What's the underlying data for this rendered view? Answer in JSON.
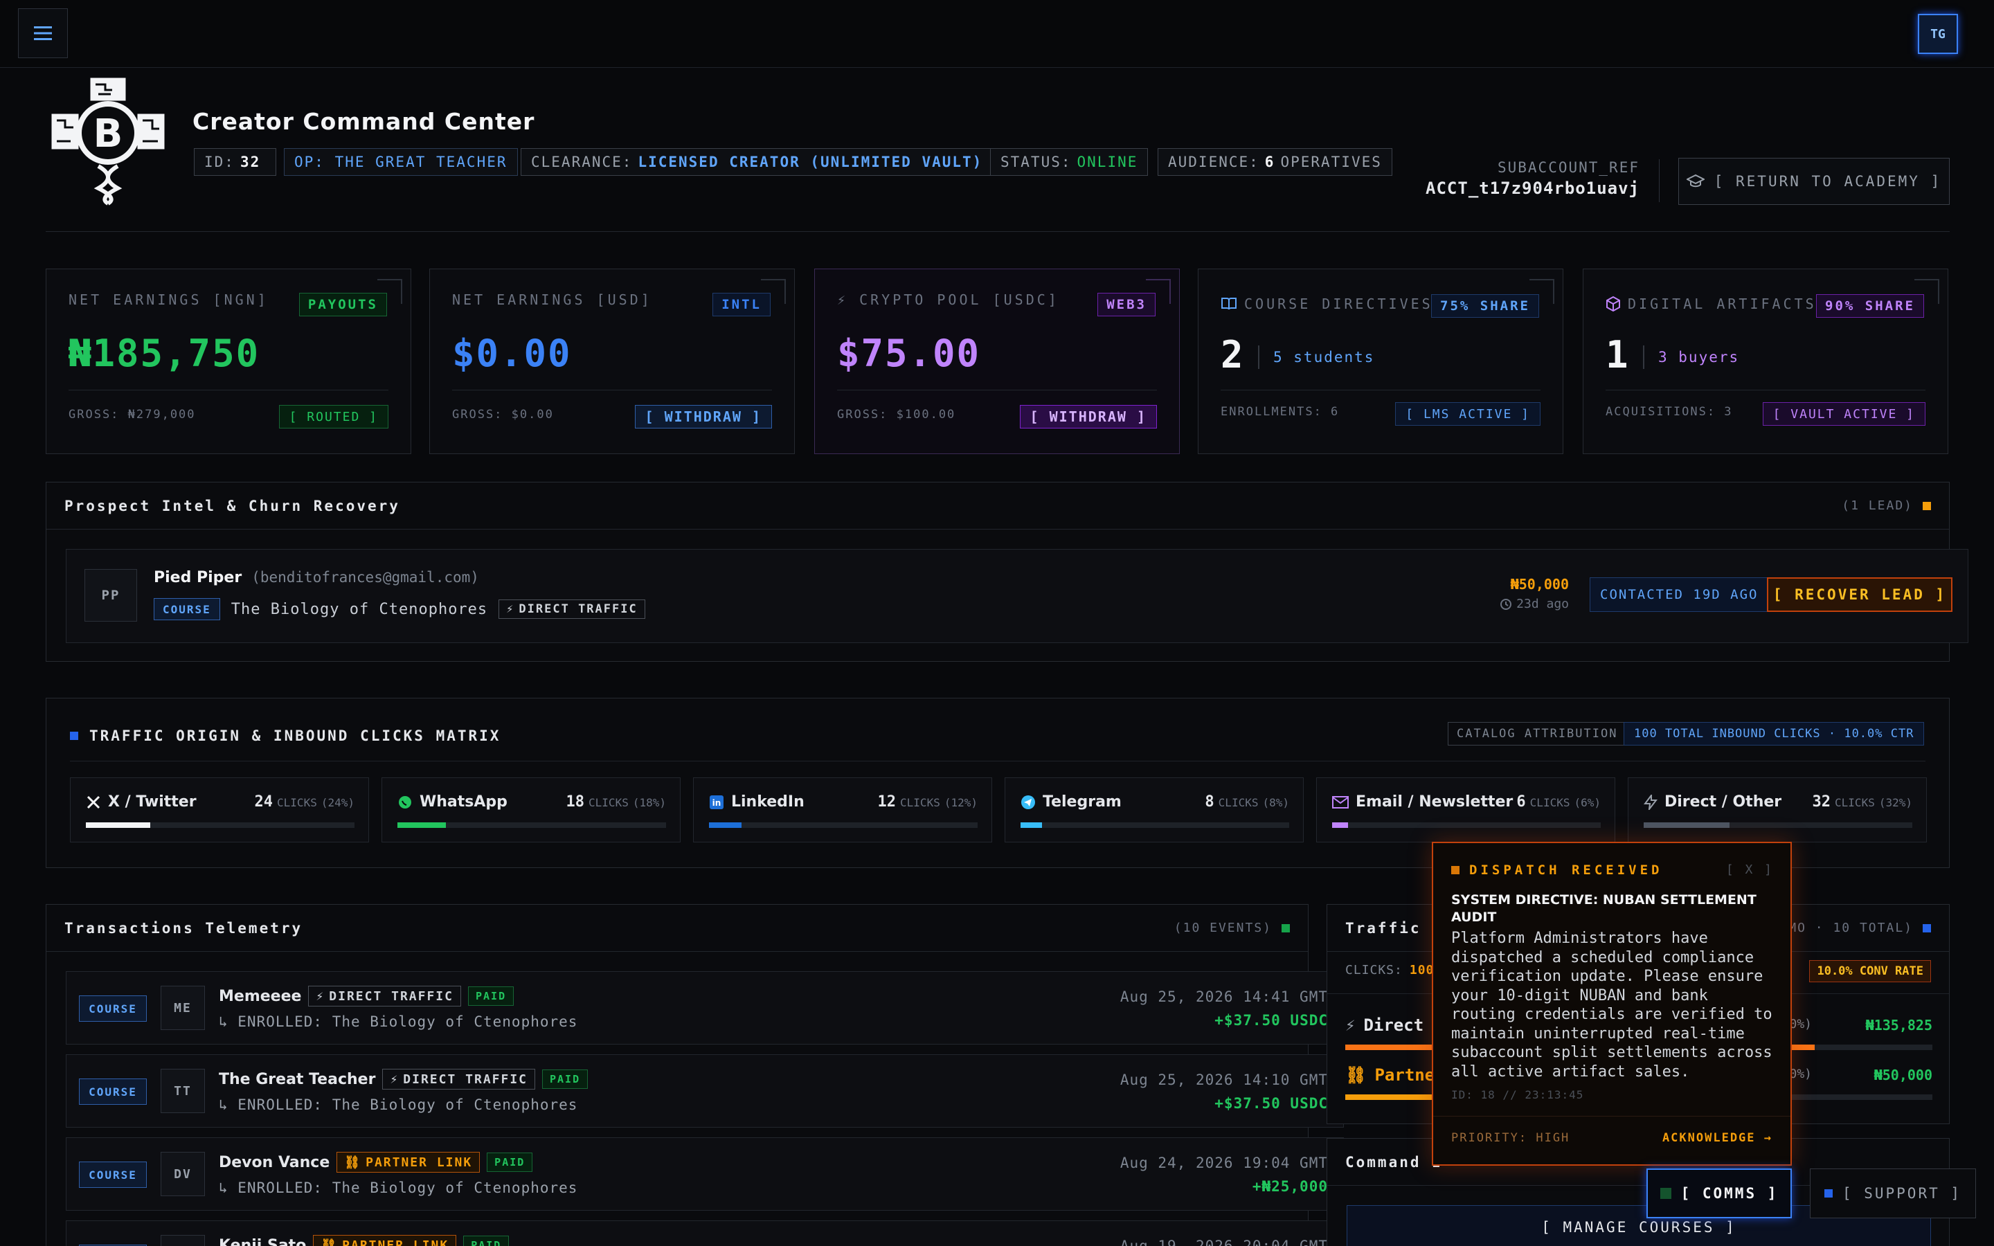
{
  "topbar": {
    "avatar_initials": "TG"
  },
  "header": {
    "title": "Creator Command Center",
    "chips": {
      "id_label": "ID:",
      "id_value": "32",
      "op": "OP: THE GREAT TEACHER",
      "clearance_label": "CLEARANCE:",
      "clearance_value": "LICENSED CREATOR (UNLIMITED VAULT)",
      "status_label": "STATUS:",
      "status_value": "ONLINE",
      "audience_label": "AUDIENCE:",
      "audience_value": "6",
      "audience_unit": "OPERATIVES"
    },
    "subaccount_label": "SUBACCOUNT_REF",
    "subaccount_value": "ACCT_t17z904rbo1uavj",
    "return_label": "[ RETURN TO ACADEMY ]"
  },
  "stats": [
    {
      "label": "NET EARNINGS [NGN]",
      "tag": "PAYOUTS",
      "value": "₦185,750",
      "gross": "GROSS: ₦279,000",
      "action": "[ ROUTED ]",
      "color": "#22c55e"
    },
    {
      "label": "NET EARNINGS [USD]",
      "tag": "INTL",
      "value": "$0.00",
      "gross": "GROSS: $0.00",
      "action": "[ WITHDRAW ]",
      "color": "#3b82f6"
    },
    {
      "label": "⚡ CRYPTO POOL [USDC]",
      "tag": "WEB3",
      "value": "$75.00",
      "gross": "GROSS: $100.00",
      "action": "[ WITHDRAW ]",
      "color": "#c084fc"
    },
    {
      "label": "COURSE DIRECTIVES",
      "tag": "75% SHARE",
      "count": "2",
      "count_sub": "5 students",
      "gross": "ENROLLMENTS: 6",
      "action": "[ LMS ACTIVE ]",
      "color": "#60a5fa"
    },
    {
      "label": "DIGITAL ARTIFACTS",
      "tag": "90% SHARE",
      "count": "1",
      "count_sub": "3 buyers",
      "gross": "ACQUISITIONS: 3",
      "action": "[ VAULT ACTIVE ]",
      "color": "#c084fc"
    }
  ],
  "prospect": {
    "title": "Prospect Intel & Churn Recovery",
    "meta": "(1 LEAD)",
    "lead": {
      "initials": "PP",
      "name": "Pied Piper",
      "email": "(benditofrances@gmail.com)",
      "type": "COURSE",
      "course": "The Biology of Ctenophores",
      "source": "DIRECT TRAFFIC",
      "amount": "₦50,000",
      "age": "23d ago",
      "contacted": "CONTACTED 19D AGO",
      "recover": "[ RECOVER LEAD ]"
    }
  },
  "traffic": {
    "title": "TRAFFIC ORIGIN & INBOUND CLICKS MATRIX",
    "attribution": "CATALOG ATTRIBUTION",
    "total": "100 TOTAL INBOUND CLICKS · 10.0% CTR",
    "clicks_word": "CLICKS",
    "sources": [
      {
        "name": "X / Twitter",
        "count": "24",
        "pct": "(24%)",
        "share": 0.24,
        "color": "#f3f4f6",
        "icon": "x-icon"
      },
      {
        "name": "WhatsApp",
        "count": "18",
        "pct": "(18%)",
        "share": 0.18,
        "color": "#22c55e",
        "icon": "whatsapp-icon"
      },
      {
        "name": "LinkedIn",
        "count": "12",
        "pct": "(12%)",
        "share": 0.12,
        "color": "#1d6fd8",
        "icon": "linkedin-icon"
      },
      {
        "name": "Telegram",
        "count": "8",
        "pct": "(8%)",
        "share": 0.08,
        "color": "#38bdf8",
        "icon": "telegram-icon"
      },
      {
        "name": "Email / Newsletter",
        "count": "6",
        "pct": "(6%)",
        "share": 0.06,
        "color": "#c084fc",
        "icon": "mail-icon"
      },
      {
        "name": "Direct / Other",
        "count": "32",
        "pct": "(32%)",
        "share": 0.32,
        "color": "#4b5563",
        "icon": "bolt-icon"
      }
    ]
  },
  "transactions": {
    "title": "Transactions Telemetry",
    "meta": "(10 EVENTS)",
    "rows": [
      {
        "type": "COURSE",
        "initials": "ME",
        "name": "Memeeee",
        "source": "DIRECT TRAFFIC",
        "status": "PAID",
        "enrolled": "↳ ENROLLED: The Biology of Ctenophores",
        "date": "Aug 25, 2026 14:41 GMT",
        "amount": "+$37.50 USDC"
      },
      {
        "type": "COURSE",
        "initials": "TT",
        "name": "The Great Teacher",
        "source": "DIRECT TRAFFIC",
        "status": "PAID",
        "enrolled": "↳ ENROLLED: The Biology of Ctenophores",
        "date": "Aug 25, 2026 14:10 GMT",
        "amount": "+$37.50 USDC"
      },
      {
        "type": "COURSE",
        "initials": "DV",
        "name": "Devon Vance",
        "source": "PARTNER LINK",
        "status": "PAID",
        "enrolled": "↳ ENROLLED: The Biology of Ctenophores",
        "date": "Aug 24, 2026 19:04 GMT",
        "amount": "+₦25,000"
      },
      {
        "type": "COURSE",
        "initials": "KS",
        "name": "Kenji Sato",
        "source": "PARTNER LINK",
        "status": "PAID",
        "enrolled": "",
        "date": "Aug 19, 2026 20:04 GMT",
        "amount": ""
      }
    ]
  },
  "traffic_origin": {
    "title_partial": "Traffic O",
    "meta_partial": "PROMO · 10 TOTAL)",
    "clicks_label": "CLICKS:",
    "clicks_value": "100",
    "conv_rate": "10.0% CONV RATE",
    "rows": [
      {
        "name": "Direct",
        "pct_partial": "O (80%)",
        "amount": "₦135,825",
        "share": 0.8,
        "color": "#f97316"
      },
      {
        "name": "Partne",
        "pct_partial": "ID (20%)",
        "amount": "₦50,000",
        "share": 0.2,
        "color": "#f59e0b"
      }
    ]
  },
  "command": {
    "title_partial": "Command I",
    "manage": "[ MANAGE COURSES ]"
  },
  "dispatch": {
    "header": "DISPATCH RECEIVED",
    "close": "[ X ]",
    "subject": "SYSTEM DIRECTIVE: NUBAN SETTLEMENT AUDIT",
    "body": "Platform Administrators have dispatched a scheduled compliance verification update. Please ensure your 10-digit NUBAN and bank routing credentials are verified to maintain uninterrupted real-time subaccount split settlements across all active artifact sales.",
    "meta": "ID: 18 // 23:13:45",
    "priority": "PRIORITY: HIGH",
    "ack": "ACKNOWLEDGE →"
  },
  "footer": {
    "comms": "[ COMMS ]",
    "support": "[ SUPPORT ]"
  }
}
